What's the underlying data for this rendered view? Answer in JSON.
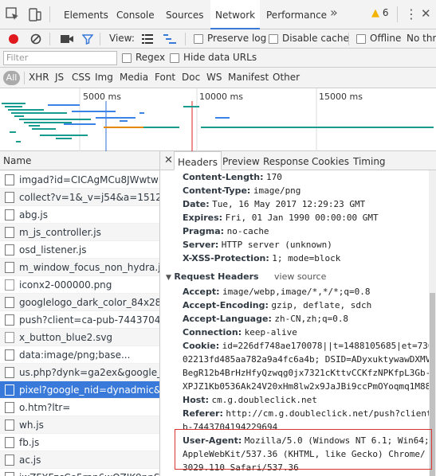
{
  "devtools": {
    "tabs": [
      "Elements",
      "Console",
      "Sources",
      "Network",
      "Performance"
    ],
    "active_tab": "Network",
    "overflow_label": "»",
    "warning_count": "6",
    "kebab_label": "⋮",
    "close_label": "✕"
  },
  "toolbar": {
    "view_label": "View:",
    "preserve_log": "Preserve log",
    "disable_cache": "Disable cache",
    "offline": "Offline",
    "throttle": "No thro"
  },
  "filter": {
    "placeholder": "Filter",
    "regex": "Regex",
    "hide_data_urls": "Hide data URLs"
  },
  "types": [
    "All",
    "XHR",
    "JS",
    "CSS",
    "Img",
    "Media",
    "Font",
    "Doc",
    "WS",
    "Manifest",
    "Other"
  ],
  "timeline": {
    "ticks": [
      "5000 ms",
      "10000 ms",
      "15000 ms"
    ]
  },
  "requests": {
    "header": "Name",
    "items": [
      {
        "name": "imgad?id=CICAgMCu8JWwtw",
        "icon": "file"
      },
      {
        "name": "collect?v=1&_v=j54&a=15129",
        "icon": "file"
      },
      {
        "name": "abg.js",
        "icon": "file"
      },
      {
        "name": "m_js_controller.js",
        "icon": "file"
      },
      {
        "name": "osd_listener.js",
        "icon": "file"
      },
      {
        "name": "m_window_focus_non_hydra.js",
        "icon": "file"
      },
      {
        "name": "iconx2-000000.png",
        "icon": "image"
      },
      {
        "name": "googlelogo_dark_color_84x28",
        "icon": "file"
      },
      {
        "name": "push?client=ca-pub-74437041",
        "icon": "file"
      },
      {
        "name": "x_button_blue2.svg",
        "icon": "image"
      },
      {
        "name": "data:image/png;base...",
        "icon": "file"
      },
      {
        "name": "us.php?dynk=ga2ex&google_",
        "icon": "file"
      },
      {
        "name": "pixel?google_nid=dynadmic&",
        "icon": "file",
        "selected": true
      },
      {
        "name": "o.htm?ltr=",
        "icon": "file"
      },
      {
        "name": "wh.js",
        "icon": "file"
      },
      {
        "name": "fb.js",
        "icon": "file"
      },
      {
        "name": "ac.js",
        "icon": "file"
      },
      {
        "name": "jwZFXFzcCe5rnn6wQZIK9ppSZ",
        "icon": "file"
      }
    ]
  },
  "detail_tabs": [
    "Headers",
    "Preview",
    "Response",
    "Cookies",
    "Timing"
  ],
  "detail_close": "✕",
  "response_headers": [
    {
      "k": "Content-Length:",
      "v": "170"
    },
    {
      "k": "Content-Type:",
      "v": "image/png"
    },
    {
      "k": "Date:",
      "v": "Tue, 16 May 2017 12:29:23 GMT"
    },
    {
      "k": "Expires:",
      "v": "Fri, 01 Jan 1990 00:00:00 GMT"
    },
    {
      "k": "Pragma:",
      "v": "no-cache"
    },
    {
      "k": "Server:",
      "v": "HTTP server (unknown)"
    },
    {
      "k": "X-XSS-Protection:",
      "v": "1; mode=block"
    }
  ],
  "request_section": {
    "title": "Request Headers",
    "view_source": "view source"
  },
  "request_headers": {
    "accept": {
      "k": "Accept:",
      "v": "image/webp,image/*,*/*;q=0.8"
    },
    "accept_encoding": {
      "k": "Accept-Encoding:",
      "v": "gzip, deflate, sdch"
    },
    "accept_language": {
      "k": "Accept-Language:",
      "v": "zh-CN,zh;q=0.8"
    },
    "connection": {
      "k": "Connection:",
      "v": "keep-alive"
    },
    "cookie": {
      "k": "Cookie:",
      "v": "id=226df748ae170078||t=1488105685|et=730",
      "lines": [
        "02213fd485aa782a9a4fc6a4b; DSID=ADyxuktywawDXMV",
        "BegR12b4BrHzHfyQzwqg0jx7321cKttvCCKfzNPKfpL3Gb-",
        "XPJZ1Kb0536Ak24V20xHm8lw2x9JaJBi9ccPmOYoqmq1M88"
      ]
    },
    "host": {
      "k": "Host:",
      "v": "cm.g.doubleclick.net"
    },
    "referer": {
      "k": "Referer:",
      "v": "http://cm.g.doubleclick.net/push?client",
      "lines": [
        "b-7443704194229694"
      ]
    },
    "user_agent": {
      "k": "User-Agent:",
      "v": "Mozilla/5.0 (Windows NT 6.1; Win64;",
      "lines": [
        " AppleWebKit/537.36 (KHTML, like Gecko) Chrome/",
        "3029.110 Safari/537.36"
      ]
    }
  },
  "colors": {
    "accent": "#3879d9",
    "highlight_box": "#dd3333",
    "warning": "#f2b400",
    "record": "#e0191e"
  }
}
